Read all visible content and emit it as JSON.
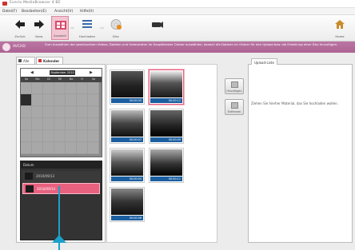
{
  "window": {
    "title": "Everio MediaBrowser 4 BE"
  },
  "menu": {
    "items": [
      "Datei(F)",
      "Bearbeiten(E)",
      "Ansicht(V)",
      "Hilfe(H)"
    ]
  },
  "toolbar": {
    "back_label": "Zurück",
    "forward_label": "Vorw.",
    "import_label": "Auswahl",
    "share_label": "Hochladen",
    "disc_label": "Disc",
    "home_label": "Home"
  },
  "infobar": {
    "mode_name": "AVCHD",
    "text": "Zum Auswählen der gewünschten Videos, Dateien und Unterordner im Hauptfenster Ordner auswählen, danach die Dateien im Ordner für den Upload bzw. die Erstellung einer Disc hinzufügen."
  },
  "tabs": {
    "tab1": "Alle",
    "tab2": "Kalender"
  },
  "calendar": {
    "month": "September 2010",
    "weekdays": [
      "So",
      "Mo",
      "Di",
      "Mi",
      "Do",
      "Fr",
      "Sa"
    ]
  },
  "datelist": {
    "header": "Datum",
    "items": [
      {
        "label": "2010/09/13",
        "selected": false
      },
      {
        "label": "2010/09/14",
        "selected": true
      }
    ]
  },
  "gallery": {
    "thumbnails": [
      {
        "caption": "00:00:05"
      },
      {
        "caption": "00:00:12"
      },
      {
        "caption": "00:00:07"
      },
      {
        "caption": "00:00:09"
      },
      {
        "caption": "00:00:04"
      },
      {
        "caption": "00:00:11"
      },
      {
        "caption": "00:00:06"
      }
    ]
  },
  "side_buttons": {
    "add_label": "Hinzufügen",
    "remove_label": "Entfernen"
  },
  "right_panel": {
    "tab_label": "Upload-Liste",
    "message": "Ziehen Sie hierher Material, das Sie hochladen wollen."
  },
  "colors": {
    "accent": "#e8617f",
    "infobar": "#b36a9b",
    "caption": "#1c5fa0"
  }
}
